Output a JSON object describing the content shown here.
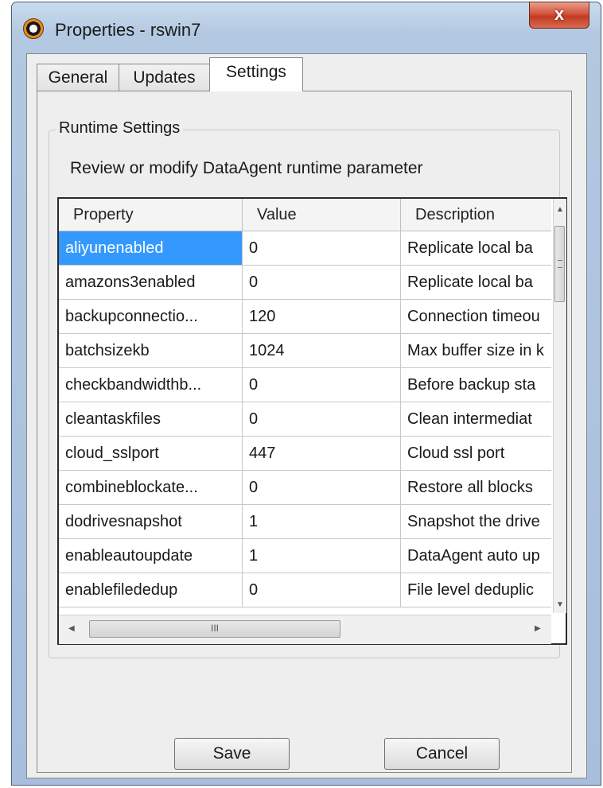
{
  "window": {
    "title": "Properties - rswin7",
    "close_glyph": "x"
  },
  "tabs": [
    {
      "label": "General",
      "active": false
    },
    {
      "label": "Updates",
      "active": false
    },
    {
      "label": "Settings",
      "active": true
    }
  ],
  "group": {
    "legend": "Runtime Settings",
    "description": "Review or modify DataAgent runtime parameter"
  },
  "table": {
    "headers": [
      "Property",
      "Value",
      "Description"
    ],
    "rows": [
      {
        "property": "aliyunenabled",
        "value": "0",
        "description": "Replicate local ba",
        "selected": true
      },
      {
        "property": "amazons3enabled",
        "value": "0",
        "description": "Replicate local ba",
        "selected": false
      },
      {
        "property": "backupconnectio...",
        "value": "120",
        "description": "Connection timeou",
        "selected": false
      },
      {
        "property": "batchsizekb",
        "value": "1024",
        "description": "Max buffer size in k",
        "selected": false
      },
      {
        "property": "checkbandwidthb...",
        "value": "0",
        "description": "Before backup sta",
        "selected": false
      },
      {
        "property": "cleantaskfiles",
        "value": "0",
        "description": "Clean intermediat",
        "selected": false
      },
      {
        "property": "cloud_sslport",
        "value": "447",
        "description": "Cloud ssl port",
        "selected": false
      },
      {
        "property": "combineblockate...",
        "value": "0",
        "description": "Restore all blocks",
        "selected": false
      },
      {
        "property": "dodrivesnapshot",
        "value": "1",
        "description": "Snapshot the drive",
        "selected": false
      },
      {
        "property": "enableautoupdate",
        "value": "1",
        "description": "DataAgent auto up",
        "selected": false
      },
      {
        "property": "enablefilededup",
        "value": "0",
        "description": "File level deduplic",
        "selected": false
      }
    ],
    "hscroll_grip": "III"
  },
  "buttons": {
    "save": "Save",
    "cancel": "Cancel"
  },
  "colors": {
    "selection": "#3399ff",
    "close_button": "#c7422a",
    "app_icon": "#f08a1a"
  },
  "icons": {
    "app": "app-logo-icon",
    "close": "close-icon"
  }
}
